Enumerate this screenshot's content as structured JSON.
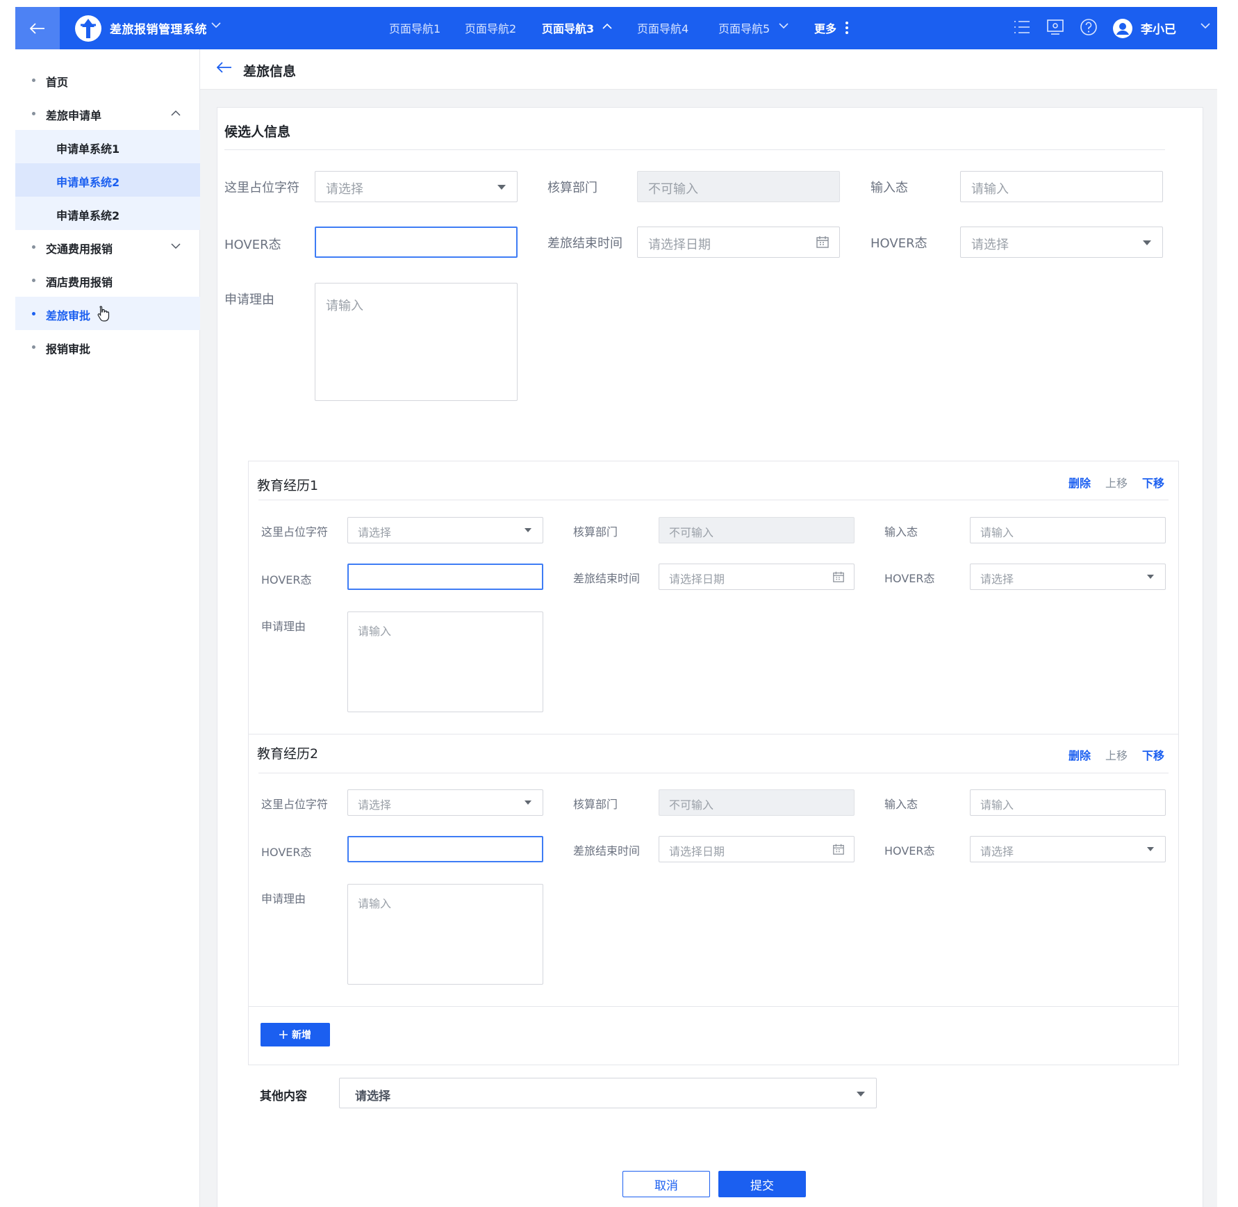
{
  "colors": {
    "primary": "#1b5ff0",
    "sidebar_selected": "#dce7fd",
    "background": "#f2f3f5"
  },
  "topbar": {
    "app_title": "差旅报销管理系统",
    "nav": [
      "页面导航1",
      "页面导航2",
      "页面导航3",
      "页面导航4",
      "页面导航5"
    ],
    "active_nav": "页面导航3",
    "more": "更多",
    "icons": [
      "list-icon",
      "screen-icon",
      "help-icon"
    ],
    "user_name": "李小已"
  },
  "sidebar": {
    "items": [
      {
        "label": "首页"
      },
      {
        "label": "差旅申请单",
        "expanded": true,
        "children": [
          {
            "label": "申请单系统1"
          },
          {
            "label": "申请单系统2",
            "selected": true
          },
          {
            "label": "申请单系统2"
          }
        ]
      },
      {
        "label": "交通费用报销",
        "expanded": false
      },
      {
        "label": "酒店费用报销"
      },
      {
        "label": "差旅审批",
        "hovered": true
      },
      {
        "label": "报销审批"
      }
    ]
  },
  "page": {
    "title": "差旅信息"
  },
  "main_form": {
    "section_title": "候选人信息",
    "labels": {
      "placeholder_field": "这里占位字符",
      "dept": "核算部门",
      "input_state": "输入态",
      "hover1": "HOVER态",
      "end_time": "差旅结束时间",
      "hover2": "HOVER态",
      "reason": "申请理由"
    },
    "placeholders": {
      "select": "请选择",
      "disabled": "不可输入",
      "input": "请输入",
      "date": "请选择日期"
    }
  },
  "education": [
    {
      "title": "教育经历1",
      "actions": {
        "delete": "删除",
        "up": "上移",
        "down": "下移"
      }
    },
    {
      "title": "教育经历2",
      "actions": {
        "delete": "删除",
        "up": "上移",
        "down": "下移"
      }
    }
  ],
  "add_button": "新增",
  "other": {
    "label": "其他内容",
    "placeholder": "请选择"
  },
  "footer": {
    "cancel": "取消",
    "submit": "提交"
  }
}
